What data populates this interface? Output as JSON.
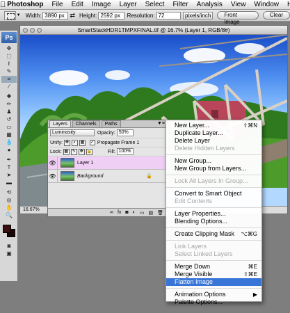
{
  "menubar": {
    "app": "Photoshop",
    "items": [
      "File",
      "Edit",
      "Image",
      "Layer",
      "Select",
      "Filter",
      "Analysis",
      "View",
      "Window",
      "Help"
    ]
  },
  "options": {
    "width_label": "Width:",
    "width_value": "3890 px",
    "height_label": "Height:",
    "height_value": "2592 px",
    "resolution_label": "Resolution:",
    "resolution_value": "72",
    "resolution_unit": "pixels/inch",
    "front_image": "Front Image",
    "clear": "Clear"
  },
  "tools": {
    "logo": "Ps"
  },
  "document": {
    "title": "SmartStackHDR1TMPXFINAL.tif @ 16.7% (Layer 1, RGB/8#)",
    "zoom": "16.67%"
  },
  "layers_panel": {
    "tabs": [
      "Layers",
      "Channels",
      "Paths"
    ],
    "blend_mode": "Luminosity",
    "opacity_label": "Opacity:",
    "opacity_value": "50%",
    "unify_label": "Unify:",
    "propagate_label": "Propagate Frame 1",
    "lock_label": "Lock:",
    "fill_label": "Fill:",
    "fill_value": "100%",
    "layers": [
      {
        "name": "Layer 1",
        "selected": true
      },
      {
        "name": "Background",
        "selected": false
      }
    ],
    "bottom_icons": [
      "fx",
      "mask",
      "adjust",
      "group",
      "new",
      "trash"
    ]
  },
  "context_menu": {
    "items": [
      {
        "label": "New Layer...",
        "shortcut": "⇧⌘N",
        "disabled": false
      },
      {
        "label": "Duplicate Layer...",
        "shortcut": "",
        "disabled": false
      },
      {
        "label": "Delete Layer",
        "shortcut": "",
        "disabled": false
      },
      {
        "label": "Delete Hidden Layers",
        "shortcut": "",
        "disabled": true
      },
      {
        "sep": true
      },
      {
        "label": "New Group...",
        "shortcut": "",
        "disabled": false
      },
      {
        "label": "New Group from Layers...",
        "shortcut": "",
        "disabled": false
      },
      {
        "sep": true
      },
      {
        "label": "Lock All Layers In Group...",
        "shortcut": "",
        "disabled": true
      },
      {
        "sep": true
      },
      {
        "label": "Convert to Smart Object",
        "shortcut": "",
        "disabled": false
      },
      {
        "label": "Edit Contents",
        "shortcut": "",
        "disabled": true
      },
      {
        "sep": true
      },
      {
        "label": "Layer Properties...",
        "shortcut": "",
        "disabled": false
      },
      {
        "label": "Blending Options...",
        "shortcut": "",
        "disabled": false
      },
      {
        "sep": true
      },
      {
        "label": "Create Clipping Mask",
        "shortcut": "⌥⌘G",
        "disabled": false
      },
      {
        "sep": true
      },
      {
        "label": "Link Layers",
        "shortcut": "",
        "disabled": true
      },
      {
        "label": "Select Linked Layers",
        "shortcut": "",
        "disabled": true
      },
      {
        "sep": true
      },
      {
        "label": "Merge Down",
        "shortcut": "⌘E",
        "disabled": false
      },
      {
        "label": "Merge Visible",
        "shortcut": "⇧⌘E",
        "disabled": false
      },
      {
        "label": "Flatten Image",
        "shortcut": "",
        "disabled": false,
        "highlighted": true
      },
      {
        "sep": true
      },
      {
        "label": "Animation Options",
        "shortcut": "▶",
        "disabled": false
      },
      {
        "label": "Palette Options...",
        "shortcut": "",
        "disabled": false
      }
    ]
  }
}
